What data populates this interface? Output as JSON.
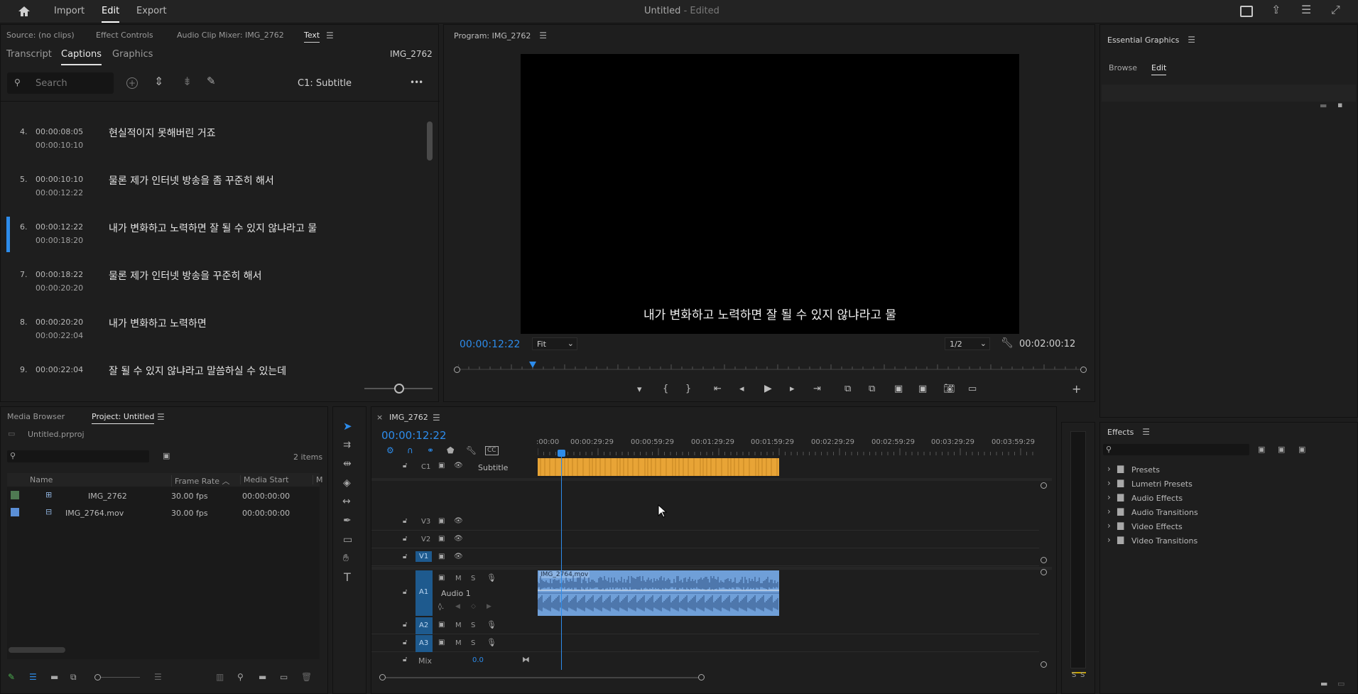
{
  "topbar": {
    "home": "home-icon",
    "menu": [
      "Import",
      "Edit",
      "Export"
    ],
    "active": "Edit",
    "title": "Untitled",
    "title_suffix": " - Edited"
  },
  "source_tabs": [
    "Source: (no clips)",
    "Effect Controls",
    "Audio Clip Mixer: IMG_2762",
    "Text"
  ],
  "text_panel": {
    "subtabs": [
      "Transcript",
      "Captions",
      "Graphics"
    ],
    "active": "Captions",
    "clip_name": "IMG_2762",
    "search_placeholder": "Search",
    "track": "C1: Subtitle",
    "more": "•••"
  },
  "captions": [
    {
      "num": "4.",
      "in": "00:00:08:05",
      "out": "00:00:10:10",
      "text": "현실적이지 못해버린 거죠"
    },
    {
      "num": "5.",
      "in": "00:00:10:10",
      "out": "00:00:12:22",
      "text": "물론 제가 인터넷 방송을 좀 꾸준히 해서"
    },
    {
      "num": "6.",
      "in": "00:00:12:22",
      "out": "00:00:18:20",
      "text": "내가 변화하고 노력하면 잘 될 수 있지 않냐라고 물"
    },
    {
      "num": "7.",
      "in": "00:00:18:22",
      "out": "00:00:20:20",
      "text": "물론 제가 인터넷 방송을 꾸준히 해서"
    },
    {
      "num": "8.",
      "in": "00:00:20:20",
      "out": "00:00:22:04",
      "text": "내가 변화하고 노력하면"
    },
    {
      "num": "9.",
      "in": "00:00:22:04",
      "out": "",
      "text": "잘 될 수 있지 않냐라고 말씀하실 수 있는데"
    }
  ],
  "program": {
    "title": "Program: IMG_2762",
    "subtitle": "내가 변화하고 노력하면 잘 될 수 있지 않냐라고 물",
    "timecode": "00:00:12:22",
    "fit": "Fit",
    "resolution": "1/2",
    "duration": "00:02:00:12"
  },
  "essential_graphics": {
    "title": "Essential Graphics",
    "tabs": [
      "Browse",
      "Edit"
    ],
    "active": "Edit"
  },
  "project": {
    "tabs": [
      "Media Browser",
      "Project: Untitled"
    ],
    "file": "Untitled.prproj",
    "items_count": "2 items",
    "columns": [
      "Name",
      "Frame Rate",
      "Media Start",
      "M"
    ],
    "rows": [
      {
        "name": "IMG_2762",
        "fps": "30.00 fps",
        "start": "00:00:00:00",
        "color": "#4f7a52"
      },
      {
        "name": "IMG_2764.mov",
        "fps": "30.00 fps",
        "start": "00:00:00:00",
        "color": "#5b8fd6"
      }
    ]
  },
  "timeline": {
    "name": "IMG_2762",
    "timecode": "00:00:12:22",
    "ruler": [
      ":00:00",
      "00:00:29:29",
      "00:00:59:29",
      "00:01:29:29",
      "00:01:59:29",
      "00:02:29:29",
      "00:02:59:29",
      "00:03:29:29",
      "00:03:59:29"
    ],
    "caption_track": {
      "id": "C1",
      "name": "Subtitle"
    },
    "video_tracks": [
      "V3",
      "V2",
      "V1"
    ],
    "audio_tracks": [
      {
        "id": "A1",
        "name": "Audio 1"
      },
      {
        "id": "A2",
        "name": ""
      },
      {
        "id": "A3",
        "name": ""
      }
    ],
    "mix_label": "Mix",
    "mix_value": "0.0",
    "audio_clip": "IMG_2764.mov",
    "playhead_fraction": 0.0497
  },
  "effects": {
    "title": "Effects",
    "items": [
      "Presets",
      "Lumetri Presets",
      "Audio Effects",
      "Audio Transitions",
      "Video Effects",
      "Video Transitions"
    ]
  },
  "meter": {
    "solo": [
      "S",
      "S"
    ]
  },
  "colors": {
    "accent": "#2d8ceb",
    "caption_clip": "#e8a436",
    "audio_clip": "#6f9fd8"
  }
}
